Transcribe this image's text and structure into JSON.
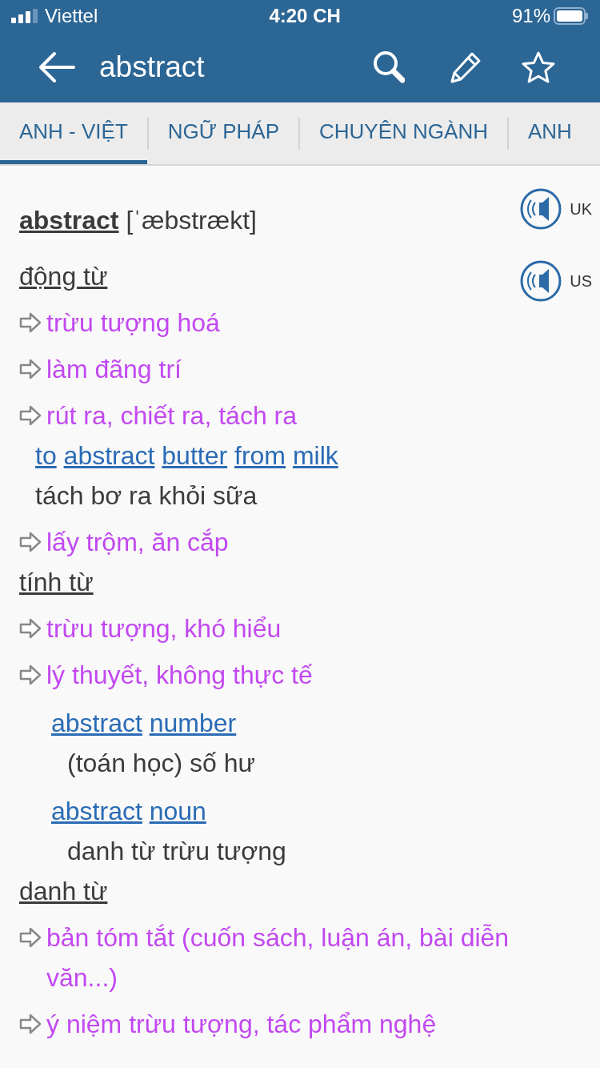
{
  "status_bar": {
    "carrier": "Viettel",
    "time": "4:20 CH",
    "battery": "91%"
  },
  "header": {
    "title": "abstract"
  },
  "tabs": [
    {
      "label": "ANH - VIỆT",
      "selected": true
    },
    {
      "label": "NGỮ PHÁP",
      "selected": false
    },
    {
      "label": "CHUYÊN NGÀNH",
      "selected": false
    },
    {
      "label": "ANH",
      "selected": false
    }
  ],
  "entry": {
    "headword": "abstract",
    "pronunciation": "[ˈæbstrækt]",
    "audio": [
      {
        "label": "UK"
      },
      {
        "label": "US"
      }
    ],
    "sections": [
      {
        "part_of_speech": "động từ",
        "senses": [
          {
            "text": "trừu tượng hoá"
          },
          {
            "text": "làm đãng trí"
          },
          {
            "text": "rút ra, chiết ra, tách ra",
            "examples": [
              {
                "words": [
                  "to",
                  "abstract",
                  "butter",
                  "from",
                  "milk"
                ],
                "translation": "tách bơ ra khỏi sữa"
              }
            ]
          },
          {
            "text": "lấy trộm, ăn cắp"
          }
        ]
      },
      {
        "part_of_speech": "tính từ",
        "senses": [
          {
            "text": "trừu tượng, khó hiểu"
          },
          {
            "text": "lý thuyết, không thực tế",
            "idioms": [
              {
                "words": [
                  "abstract",
                  "number"
                ],
                "translation": "(toán học) số hư"
              },
              {
                "words": [
                  "abstract",
                  "noun"
                ],
                "translation": "danh từ trừu tượng"
              }
            ]
          }
        ]
      },
      {
        "part_of_speech": "danh từ",
        "senses": [
          {
            "text": "bản tóm tắt (cuốn sách, luận án, bài diễn văn...)"
          },
          {
            "text": "ý niệm trừu tượng, tác phẩm nghệ"
          }
        ]
      }
    ]
  }
}
